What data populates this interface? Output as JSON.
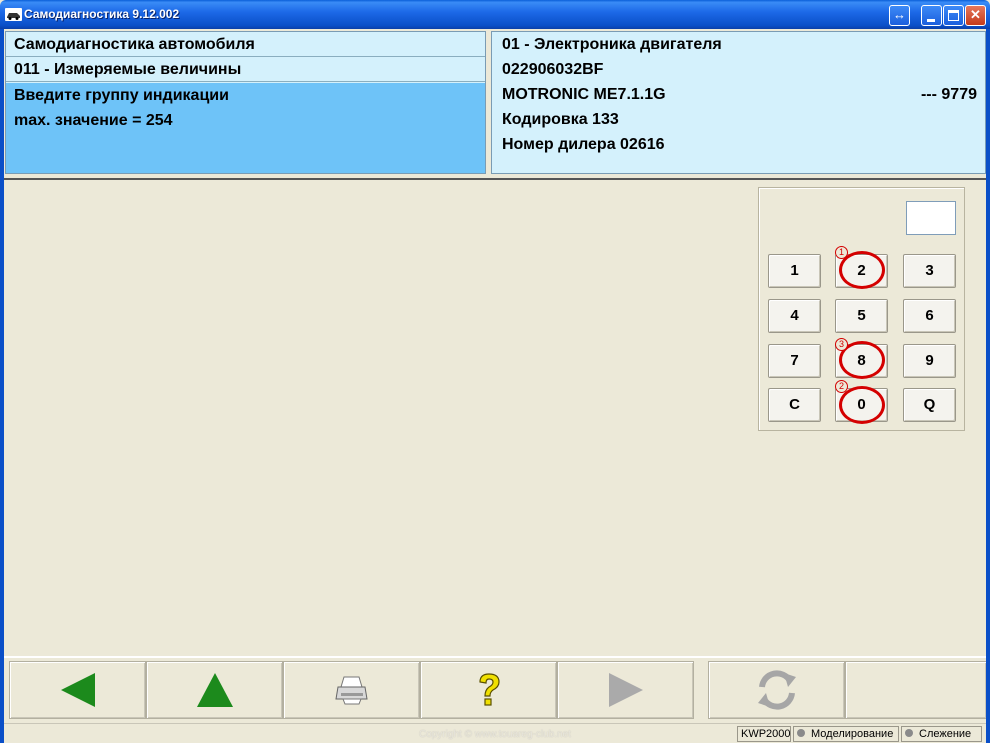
{
  "window": {
    "title": "Самодиагностика 9.12.002"
  },
  "left_panel": {
    "title": "Самодиагностика автомобиля",
    "function": "011 - Измеряемые величины",
    "prompt_line_1": "Введите группу индикации",
    "prompt_line_2": "max. значение = 254"
  },
  "right_panel": {
    "controller": "01 - Электроника двигателя",
    "part_number": "022906032BF",
    "ecu_name": "MOTRONIC ME7.1.1G",
    "ecu_version": "---  9779",
    "coding": "Кодировка 133",
    "dealer": "Номер дилера 02616"
  },
  "keypad": {
    "display_value": "",
    "keys": [
      "1",
      "2",
      "3",
      "4",
      "5",
      "6",
      "7",
      "8",
      "9",
      "C",
      "0",
      "Q"
    ],
    "marks": [
      "1",
      "3",
      "2"
    ]
  },
  "toolbar": {
    "icons": [
      "back-arrow-icon",
      "up-arrow-icon",
      "printer-icon",
      "help-icon",
      "forward-arrow-icon",
      "refresh-icon"
    ],
    "colors": {
      "arrow_active": "#1c8a1c",
      "arrow_disabled": "#aaaaaa",
      "help": "#f0e000"
    }
  },
  "statusbar": {
    "copyright": "Copyright © www.touareg-club.net",
    "protocol": "KWP2000",
    "simulation": "Моделирование",
    "tracking": "Слежение"
  },
  "colors": {
    "panel_bg": "#d4f1fc",
    "prompt_bg": "#6ec3f8",
    "window_bg": "#ece9d8",
    "mark_red": "#d40000"
  }
}
